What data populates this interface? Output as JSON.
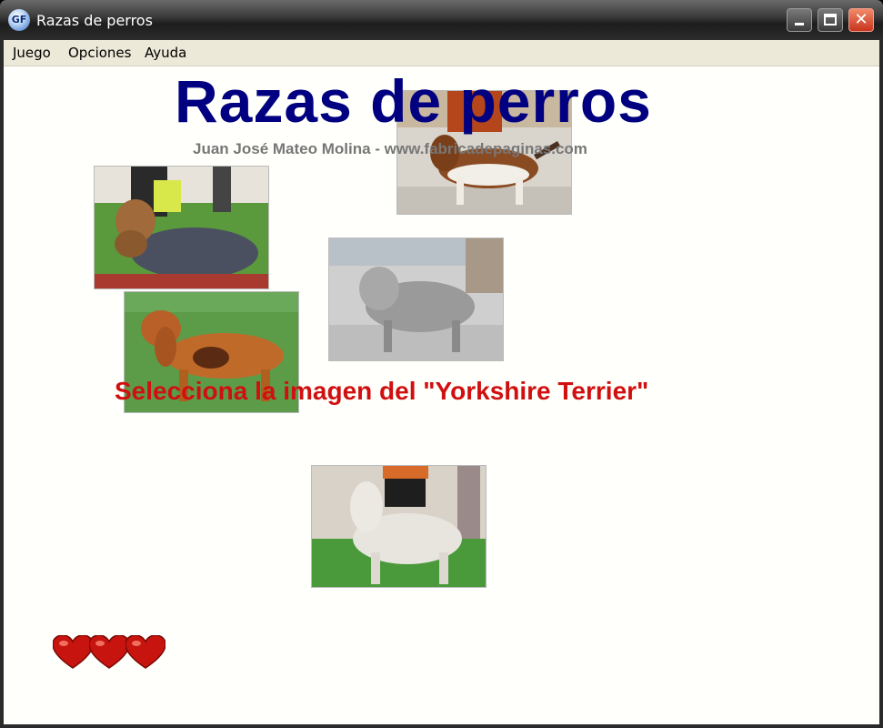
{
  "window": {
    "title": "Razas de perros",
    "app_icon_text": "GF"
  },
  "menu": {
    "items": [
      "Juego",
      "Opciones",
      "Ayuda"
    ]
  },
  "game": {
    "heading": "Razas de perros",
    "subheading": "Juan José Mateo Molina - www.fabricadepaginas.com",
    "instruction": "Selecciona la imagen del \"Yorkshire Terrier\"",
    "lives": 3,
    "images": [
      {
        "name": "dog-photo-beagle",
        "breed": "beagle"
      },
      {
        "name": "dog-photo-yorkshire-terrier",
        "breed": "yorkshire"
      },
      {
        "name": "dog-photo-grey-terrier",
        "breed": "grey-terrier"
      },
      {
        "name": "dog-photo-cocker-spaniel",
        "breed": "cocker"
      },
      {
        "name": "dog-photo-white-terrier",
        "breed": "white-terrier"
      }
    ]
  },
  "colors": {
    "heading": "#000080",
    "instruction": "#d01010",
    "subheading": "#777777",
    "heart": "#c8140e",
    "background": "#fffffb"
  }
}
